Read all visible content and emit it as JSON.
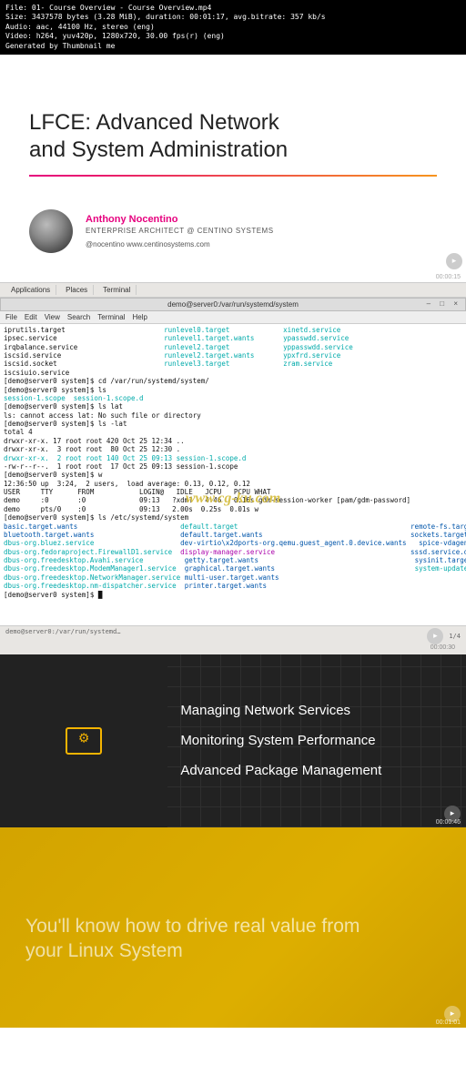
{
  "meta": {
    "file": "File: 01- Course Overview - Course Overview.mp4",
    "size": "Size: 3437578 bytes (3.28 MiB), duration: 00:01:17, avg.bitrate: 357 kb/s",
    "audio": "Audio: aac, 44100 Hz, stereo (eng)",
    "video": "Video: h264, yuv420p, 1280x720, 30.00 fps(r) (eng)",
    "gen": "Generated by Thumbnail me"
  },
  "slide1": {
    "title_line1": "LFCE: Advanced Network",
    "title_line2": "and System Administration",
    "author_name": "Anthony Nocentino",
    "author_role": "ENTERPRISE ARCHITECT @ CENTINO SYSTEMS",
    "author_handle": "@nocentino www.centinosystems.com",
    "timestamp": "00:00:15"
  },
  "gnome": {
    "applications": "Applications",
    "places": "Places",
    "terminal": "Terminal"
  },
  "term": {
    "title": "demo@server0:/var/run/systemd/system",
    "menu": [
      "File",
      "Edit",
      "View",
      "Search",
      "Terminal",
      "Help"
    ],
    "lines_plain": [
      "iprutils.target",
      "ipsec.service",
      "irqbalance.service",
      "iscsid.service",
      "iscsid.socket",
      "iscsiuio.service",
      "[demo@server0 system]$ cd /var/run/systemd/system/",
      "[demo@server0 system]$ ls",
      "session-1.scope  session-1.scope.d",
      "[demo@server0 system]$ ls lat",
      "ls: cannot access lat: No such file or directory",
      "[demo@server0 system]$ ls -lat",
      "total 4",
      "drwxr-xr-x. 17 root root 420 Oct 25 12:34 ..",
      "drwxr-xr-x.  3 root root  80 Oct 25 12:30 .",
      "drwxr-xr-x.  2 root root 140 Oct 25 09:13 session-1.scope.d",
      "-rw-r--r--.  1 root root  17 Oct 25 09:13 session-1.scope",
      "[demo@server0 system]$ w",
      "12:36:50 up  3:24,  2 users,  load average: 0.13, 0.12, 0.12",
      "USER     TTY      FROM           LOGIN@   IDLE   JCPU   PCPU WHAT",
      "demo     :0       :0             09:13   ?xdm?   4:46   0.16s gdm-session-worker [pam/gdm-password]",
      "demo     pts/0    :0             09:13   2.00s  0.25s  0.01s w",
      "[demo@server0 system]$ ls /etc/systemd/system",
      "[demo@server0 system]$ █"
    ],
    "col1_cyan": [
      "runlevel0.target",
      "runlevel1.target.wants",
      "runlevel2.target",
      "runlevel2.target.wants",
      "runlevel3.target"
    ],
    "col2_cyan": [
      "xinetd.service",
      "ypasswdd.service",
      "yppasswdd.service",
      "ypxfrd.service",
      "zram.service"
    ],
    "blue_left": [
      "basic.target.wants",
      "bluetooth.target.wants",
      "dbus-org.bluez.service",
      "dbus-org.fedoraproject.FirewallD1.service",
      "dbus-org.freedesktop.Avahi.service",
      "dbus-org.freedesktop.ModemManager1.service",
      "dbus-org.freedesktop.NetworkManager.service",
      "dbus-org.freedesktop.nm-dispatcher.service"
    ],
    "blue_mid": [
      "default.target",
      "default.target.wants",
      "dev-virtio\\x2dports-org.qemu.guest_agent.0.device.wants",
      "display-manager.service",
      "getty.target.wants",
      "graphical.target.wants",
      "multi-user.target.wants",
      "printer.target.wants"
    ],
    "blue_right": [
      "remote-fs.target.wants",
      "sockets.target.wants",
      "spice-vdagentd.target.wants",
      "sssd.service.d",
      "sysinit.target.wants",
      "system-update.target.wants"
    ],
    "watermark": "www.cg-ku.com",
    "scroll_left": "demo@server0:/var/run/systemd…",
    "scroll_right": "1/4",
    "timestamp": "00:00:30"
  },
  "slide2": {
    "items": [
      "Managing Network Services",
      "Monitoring System Performance",
      "Advanced Package Management"
    ],
    "timestamp": "00:00:46"
  },
  "slide3": {
    "headline": "You'll know how to drive real value from your Linux System",
    "timestamp": "00:01:01"
  }
}
